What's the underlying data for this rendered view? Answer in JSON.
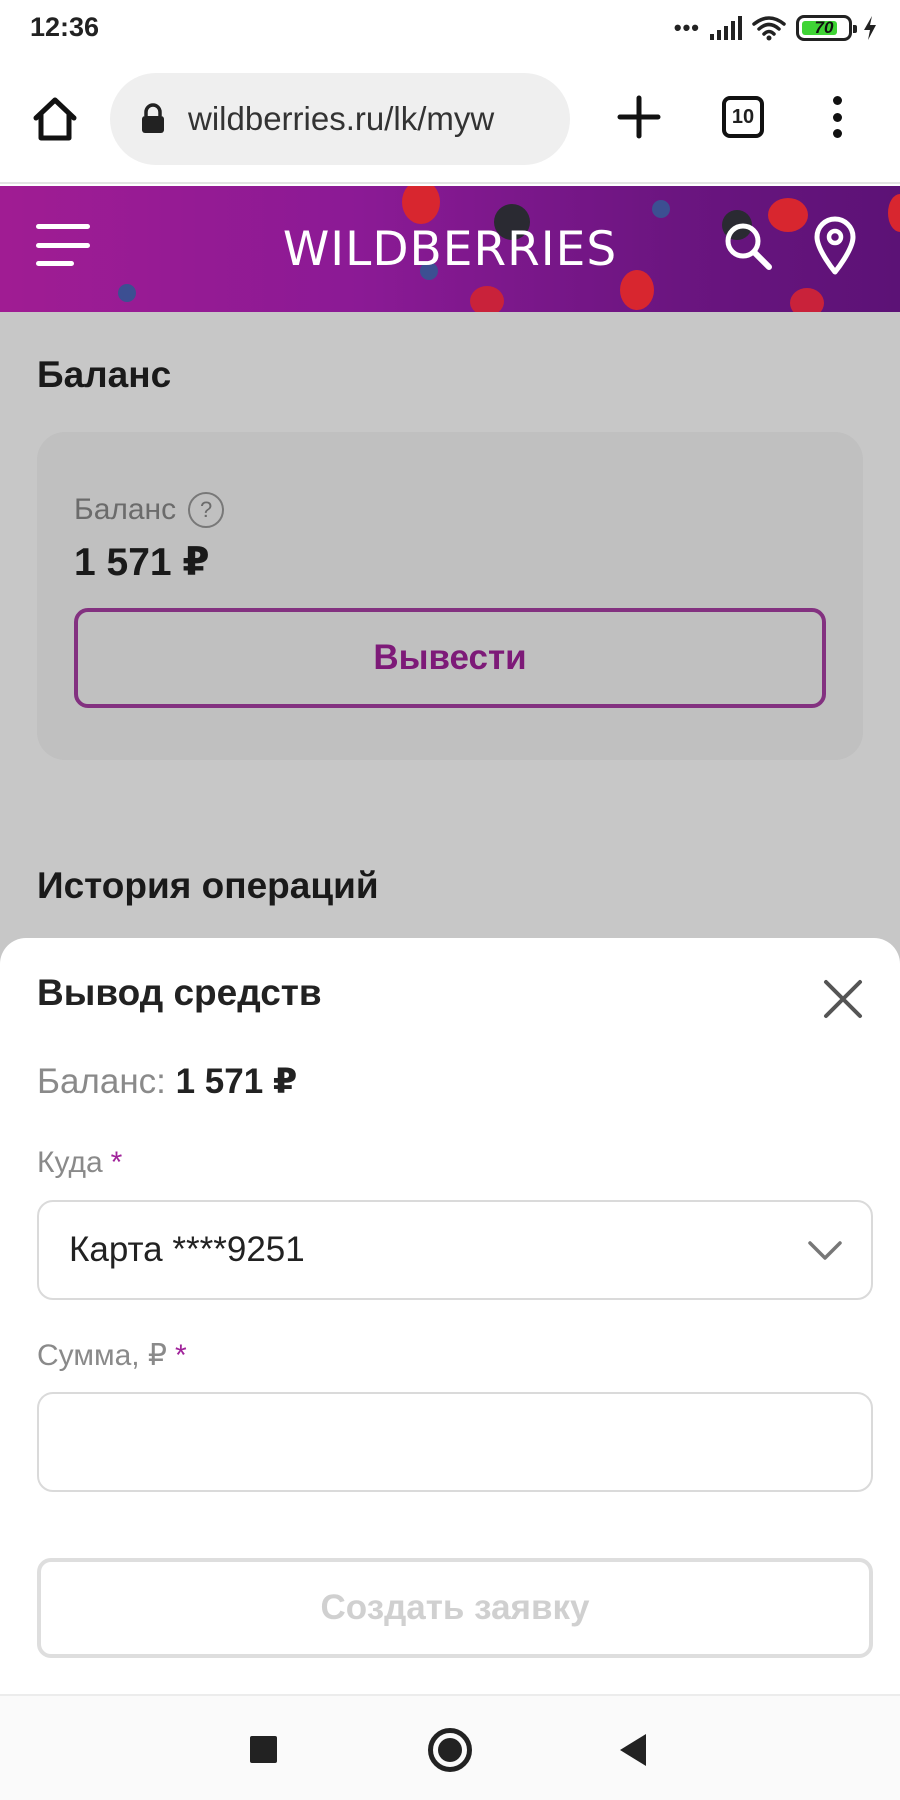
{
  "status_bar": {
    "time": "12:36",
    "dots": "•••",
    "battery": "70",
    "icons": [
      "signal-icon",
      "wifi-icon",
      "battery-icon",
      "charging-icon"
    ]
  },
  "browser": {
    "url": "wildberries.ru/lk/myw",
    "tab_count": "10",
    "icons": [
      "home-icon",
      "lock-icon",
      "plus-icon",
      "tabs-icon",
      "kebab-menu-icon"
    ]
  },
  "site_header": {
    "logo": "WILDBERRIES",
    "colors": {
      "accent_start": "#a01c93",
      "accent_end": "#5c1276"
    },
    "icons": [
      "burger-menu-icon",
      "search-icon",
      "location-pin-icon"
    ]
  },
  "page": {
    "title": "Баланс",
    "balance_card": {
      "label": "Баланс",
      "help": "?",
      "value": "1 571 ₽",
      "withdraw_label": "Вывести"
    },
    "history_title": "История операций"
  },
  "sheet": {
    "title": "Вывод средств",
    "balance_label": "Баланс: ",
    "balance_value": "1 571 ₽",
    "destination_label": "Куда",
    "required_mark": "*",
    "destination_value": "Карта ****9251",
    "amount_label": "Сумма, ₽",
    "amount_value": "",
    "submit_label": "Создать заявку",
    "colors": {
      "accent": "#a0229a",
      "disabled": "#d0d0d0"
    }
  },
  "nav_bar": {
    "icons": [
      "recent-apps-icon",
      "home-circle-icon",
      "back-icon"
    ]
  }
}
